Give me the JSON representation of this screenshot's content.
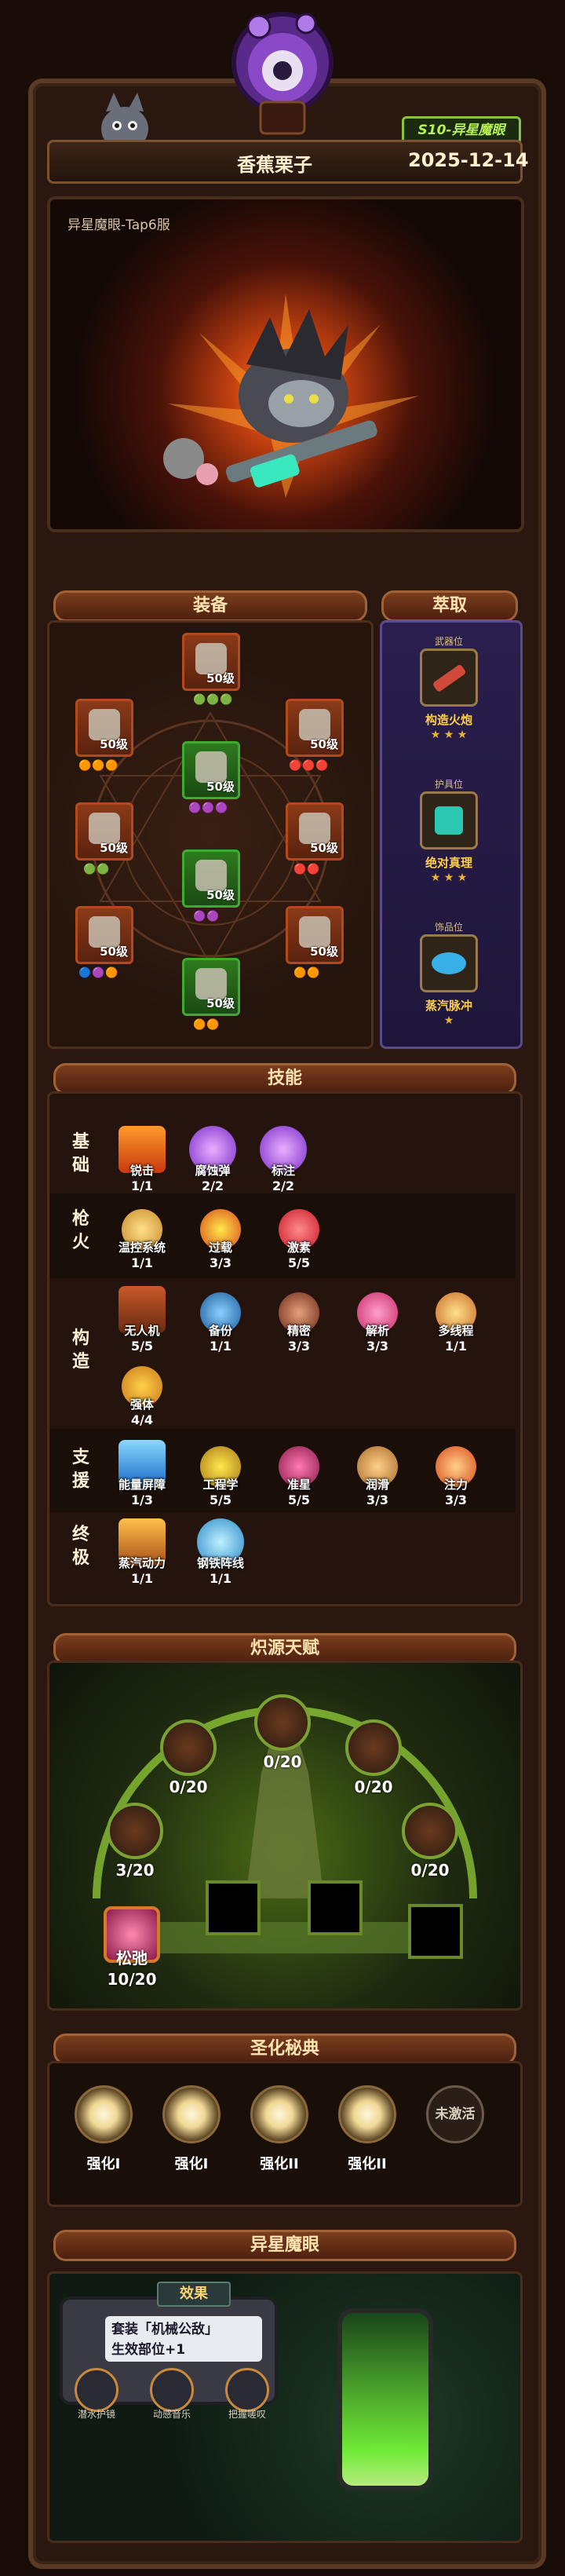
{
  "header": {
    "player_name": "香蕉栗子",
    "date": "2025-12-14",
    "season_badge": "S10-异星魔眼"
  },
  "hero": {
    "caption": "异星魔眼-Tap6服"
  },
  "sections": {
    "equipment": "装备",
    "extract": "萃取",
    "skills": "技能",
    "talents": "炽源天赋",
    "holy": "圣化秘典",
    "eye": "异星魔眼"
  },
  "equipment": {
    "slots": [
      {
        "level": "50级",
        "gems": "🟢🟢🟢"
      },
      {
        "level": "50级",
        "gems": "🟠🟠🟠"
      },
      {
        "level": "50级",
        "gems": "🔴🔴🔴"
      },
      {
        "level": "50级",
        "gems": "🟣🟣🟣"
      },
      {
        "level": "50级",
        "gems": "🟢🟢"
      },
      {
        "level": "50级",
        "gems": "🔴🔴"
      },
      {
        "level": "50级",
        "gems": "🟣🟣"
      },
      {
        "level": "50级",
        "gems": "🔵🟣🟠"
      },
      {
        "level": "50级",
        "gems": "🟠🟠"
      },
      {
        "level": "50级",
        "gems": "🟠🟠"
      }
    ]
  },
  "extract": {
    "items": [
      {
        "slot": "武器位",
        "name": "构造火炮",
        "stars": "★ ★ ★"
      },
      {
        "slot": "护具位",
        "name": "绝对真理",
        "stars": "★ ★ ★"
      },
      {
        "slot": "饰品位",
        "name": "蒸汽脉冲",
        "stars": "★"
      }
    ]
  },
  "skills": {
    "categories": [
      {
        "label": "基础",
        "items": [
          {
            "name": "锐击",
            "count": "1/1"
          },
          {
            "name": "腐蚀弹",
            "count": "2/2"
          },
          {
            "name": "标注",
            "count": "2/2"
          }
        ]
      },
      {
        "label": "枪火",
        "items": [
          {
            "name": "温控系统",
            "count": "1/1"
          },
          {
            "name": "过载",
            "count": "3/3"
          },
          {
            "name": "激素",
            "count": "5/5"
          }
        ]
      },
      {
        "label": "构造",
        "items": [
          {
            "name": "无人机",
            "count": "5/5"
          },
          {
            "name": "备份",
            "count": "1/1"
          },
          {
            "name": "精密",
            "count": "3/3"
          },
          {
            "name": "解析",
            "count": "3/3"
          },
          {
            "name": "多线程",
            "count": "1/1"
          },
          {
            "name": "强体",
            "count": "4/4"
          }
        ]
      },
      {
        "label": "支援",
        "items": [
          {
            "name": "能量屏障",
            "count": "1/3"
          },
          {
            "name": "工程学",
            "count": "5/5"
          },
          {
            "name": "准星",
            "count": "5/5"
          },
          {
            "name": "润滑",
            "count": "3/3"
          },
          {
            "name": "注力",
            "count": "3/3"
          }
        ]
      },
      {
        "label": "终极",
        "items": [
          {
            "name": "蒸汽动力",
            "count": "1/1"
          },
          {
            "name": "钢铁阵线",
            "count": "1/1"
          }
        ]
      }
    ]
  },
  "talents": {
    "nodes": [
      {
        "value": "0/20"
      },
      {
        "value": "0/20"
      },
      {
        "value": "0/20"
      },
      {
        "value": "3/20"
      },
      {
        "value": "0/20"
      },
      {
        "name": "松弛",
        "value": "10/20"
      }
    ]
  },
  "holy": {
    "orbs": [
      "强化I",
      "强化I",
      "强化II",
      "强化II"
    ],
    "inactive_label": "未激活"
  },
  "eye": {
    "effect_title": "效果",
    "effect_lines": [
      "套装「机械公敌」",
      "生效部位+1"
    ],
    "buttons": [
      "潜水护镜",
      "动感音乐",
      "把握嗟叹"
    ]
  }
}
